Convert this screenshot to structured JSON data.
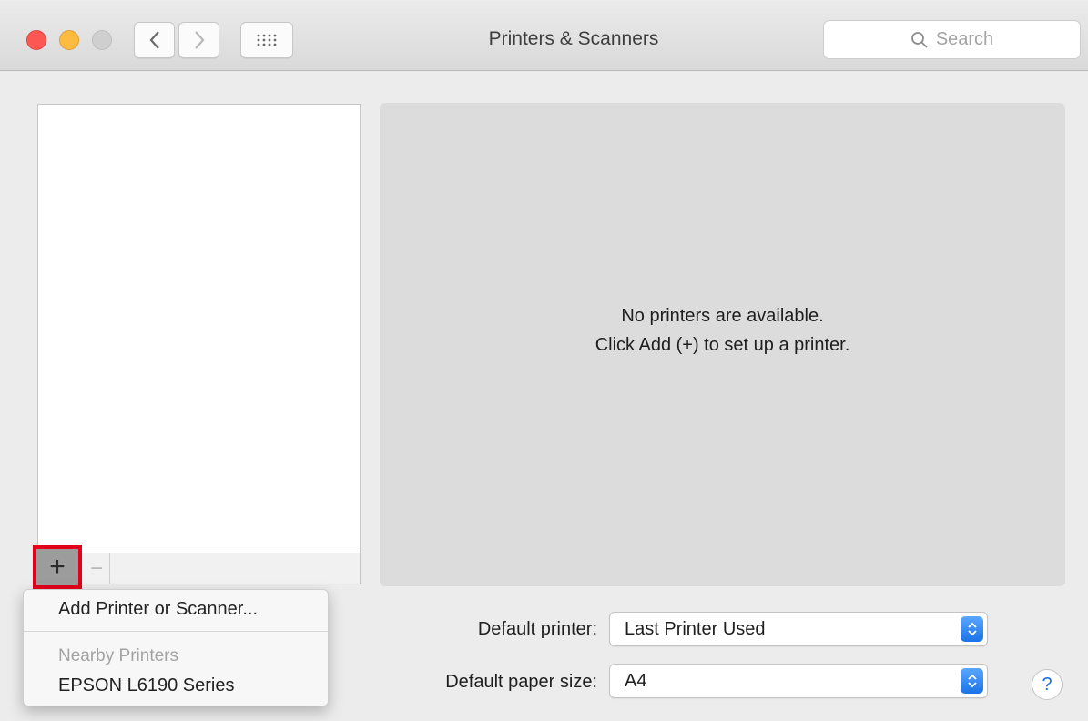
{
  "window": {
    "title": "Printers & Scanners"
  },
  "search": {
    "placeholder": "Search"
  },
  "detail": {
    "message_line1": "No printers are available.",
    "message_line2": "Click Add (+) to set up a printer."
  },
  "toolbar": {
    "add_label": "+",
    "remove_label": "−"
  },
  "defaults": {
    "printer_label": "Default printer:",
    "printer_value": "Last Printer Used",
    "paper_label": "Default paper size:",
    "paper_value": "A4"
  },
  "help": {
    "label": "?"
  },
  "add_menu": {
    "add_item": "Add Printer or Scanner...",
    "nearby_header": "Nearby Printers",
    "nearby_items": [
      "EPSON L6190 Series"
    ]
  },
  "colors": {
    "highlight_border": "#e3001b",
    "accent": "#1a73e8"
  }
}
